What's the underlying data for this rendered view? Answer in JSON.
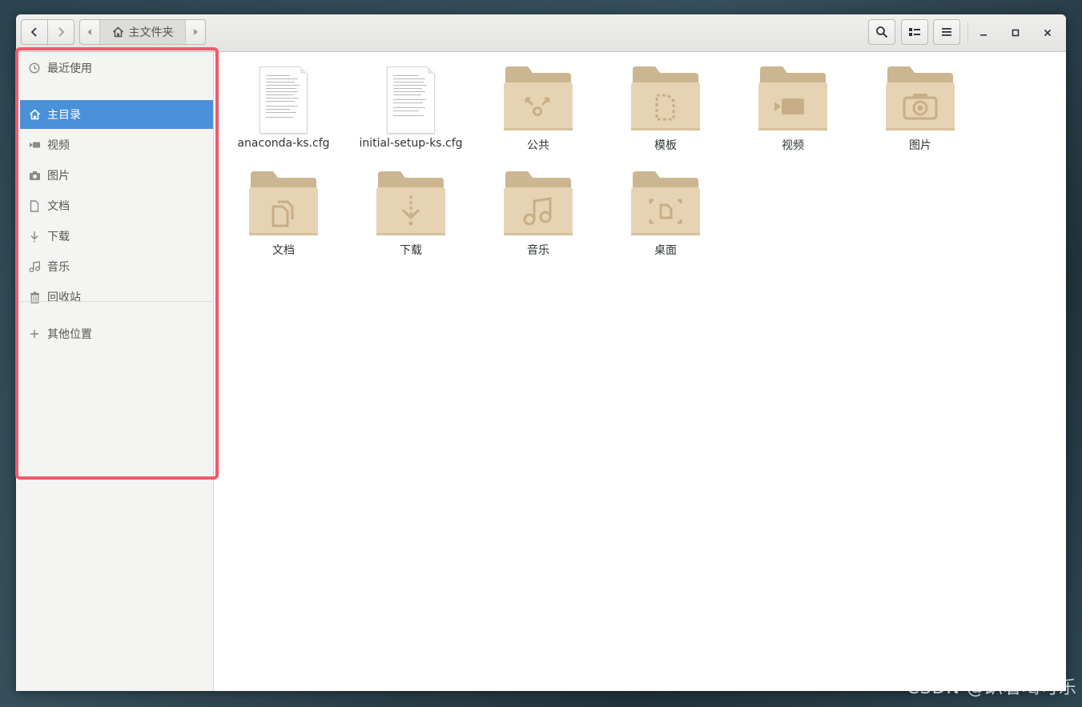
{
  "headerbar": {
    "path_current": "主文件夹"
  },
  "sidebar": {
    "items": [
      {
        "label": "最近使用",
        "icon": "recent-icon"
      },
      {
        "label": "主目录",
        "icon": "home-icon",
        "active": true
      },
      {
        "label": "视频",
        "icon": "video-icon"
      },
      {
        "label": "图片",
        "icon": "camera-icon"
      },
      {
        "label": "文档",
        "icon": "document-icon"
      },
      {
        "label": "下载",
        "icon": "download-icon"
      },
      {
        "label": "音乐",
        "icon": "music-icon"
      },
      {
        "label": "回收站",
        "icon": "trash-icon"
      }
    ],
    "other_locations": {
      "label": "其他位置",
      "icon": "plus-icon"
    }
  },
  "files": [
    {
      "name": "anaconda-ks.cfg",
      "kind": "text-file"
    },
    {
      "name": "initial-setup-ks.cfg",
      "kind": "text-file"
    },
    {
      "name": "公共",
      "kind": "folder-public"
    },
    {
      "name": "模板",
      "kind": "folder-templates"
    },
    {
      "name": "视频",
      "kind": "folder-videos"
    },
    {
      "name": "图片",
      "kind": "folder-pictures"
    },
    {
      "name": "文档",
      "kind": "folder-documents"
    },
    {
      "name": "下载",
      "kind": "folder-downloads"
    },
    {
      "name": "音乐",
      "kind": "folder-music"
    },
    {
      "name": "桌面",
      "kind": "folder-desktop"
    }
  ],
  "colors": {
    "accent": "#4a90d9",
    "folder_body": "#e6d3b4",
    "folder_back": "#cbb691",
    "folder_glyph": "#c8ae86",
    "highlight": "#f35a6a"
  },
  "watermark": "CSDN @趴着喝可乐"
}
